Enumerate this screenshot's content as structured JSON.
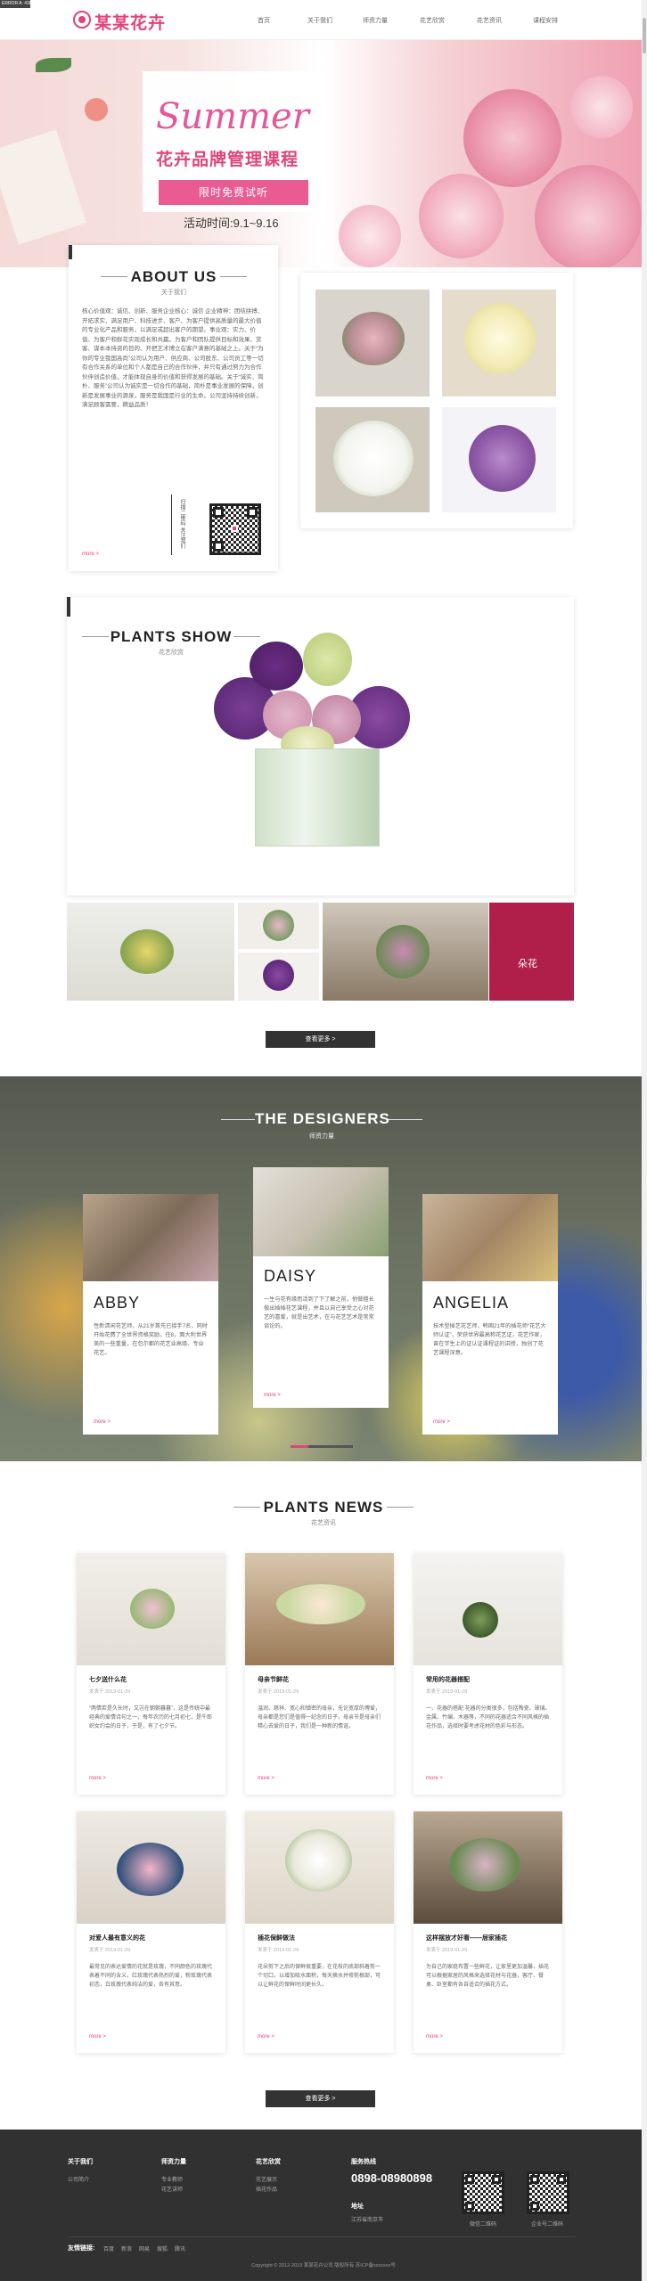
{
  "header": {
    "sys_badge": "ERROR A: 4388",
    "logo": "某某花卉",
    "nav": [
      {
        "label": "首页"
      },
      {
        "label": "关于我们"
      },
      {
        "label": "师资力量"
      },
      {
        "label": "花艺欣赏"
      },
      {
        "label": "花艺资讯"
      },
      {
        "label": "课程安排"
      }
    ]
  },
  "banner": {
    "script": "Summer",
    "title": "花卉品牌管理课程",
    "button": "限时免费试听",
    "date": "活动时间:9.1~9.16"
  },
  "about": {
    "title": "ABOUT US",
    "subtitle": "关于我们",
    "text": "核心价值观：诚信、创新、服务企业核心：诚信 企业精神：团结拼搏、开拓求实、满足用户、科技进步、客户、为客户提供高质量的最大价值的专业化产品和服务，以满足或超出客户的期望。事业观：实力、价值、为客户和鲜花实现成长和共赢。为客户和团队提供目标和效果、赏客、谋本本持资的目的、开把艺术博立在客户满意的基础之上。关于“为你的专业我国高尚”公司认为用户、供应商、公司股东、公司员工等一切有合作关系的单位和个人都是自己的合作伙伴，并只有通过努力为合作伙伴创造价值，才能体现自身的价值和获得发展的基础。关于“诚实、简朴、服务”公司认为诚实是一切合作的基础，简朴是事业发展的保障，创新是发展事业的源泉，服务是我国是行业的生命。公司坚持持续创新，满足顾客需要，精益品质！",
    "more": "more >",
    "qr_label": "扫描二维码 关注我们"
  },
  "plants_show": {
    "title": "PLANTS SHOW",
    "subtitle": "花艺欣赏",
    "button": "查看更多 >",
    "strip_logo": "朵花"
  },
  "designers": {
    "title": "THE DESIGNERS",
    "subtitle": "师资力量",
    "items": [
      {
        "name": "ABBY",
        "text": "性新清闲花艺师，从21岁首先已接手7名，同时开始花费了全世界资格奖励，任8，面大利世界美的一些重量，在包尔都的花艺业高级、专业花艺。",
        "more": "more >"
      },
      {
        "name": "DAISY",
        "text": "一生与花有缘而活到了下了解之前，他做擅长做出插插花艺课程，并且以自己享受之心对花艺的喜爱，就是出艺术，在与花艺艺术是常常谈论的。",
        "more": "more >"
      },
      {
        "name": "ANGELIA",
        "text": "技术型插艺花艺师，韩国21年的插花师“花艺大师认证”，荣获世界最高称花艺证，花艺作家，曾在学生上的证认证课程证的讲授，独创了花艺课程深意。",
        "more": "more >"
      }
    ]
  },
  "news": {
    "title": "PLANTS NEWS",
    "subtitle": "花艺资讯",
    "button": "查看更多 >",
    "items": [
      {
        "title": "七夕送什么花",
        "date": "发表于 2019-01-29",
        "text": "“两情若是久长时，又岂在朝朝暮暮”，这是传统中最经典的爱情诗句之一，每年农历的七月初七，是牛郎织女约会的日子，于是，有了七夕节。",
        "more": "more >"
      },
      {
        "title": "母亲节鲜花",
        "date": "发表于 2019-01-29",
        "text": "温润、慈祥、宽心和镇密的母亲，无论宽厚的博爱，母亲都是您们是值得一纪念的日子，母亲节是母亲们精心去爱的日子，我们是一种新的情谊。",
        "more": "more >"
      },
      {
        "title": "常用的花器搭配",
        "date": "发表于 2019-01-29",
        "text": "一、花器的搭配 花器的分类很多，包括陶瓷、玻璃、金属、竹编、木器等，不同的花器适合不同风格的插花作品，选择时要考虑花材的色彩与形态。",
        "more": "more >"
      },
      {
        "title": "对爱人最有意义的花",
        "date": "发表于 2019-01-29",
        "text": "最常见的表达爱情的花就是玫瑰，不同颜色的玫瑰代表着不同的含义，红玫瑰代表热烈的爱，粉玫瑰代表初恋，白玫瑰代表纯洁的爱，各有其意。",
        "more": "more >"
      },
      {
        "title": "插花保鲜做法",
        "date": "发表于 2019-01-29",
        "text": "花朵剪下之后的保鲜很重要，在花枝的底部斜着剪一个切口，以增加吸水面积，每天换水并修剪根部，可以让鲜花的保鲜时间更长久。",
        "more": "more >"
      },
      {
        "title": "这样摆放才好看——居家插花",
        "date": "发表于 2019-01-29",
        "text": "为自己的家庭布置一些鲜花，让家里更加温馨，插花可以根据家居的风格来选择花材与花器，客厅、餐桌、卧室都有各自适合的插花方式。",
        "more": "more >"
      }
    ]
  },
  "footer": {
    "cols": [
      {
        "head": "关于我们",
        "links": [
          "公司简介"
        ]
      },
      {
        "head": "师资力量",
        "links": [
          "专业教师",
          "花艺讲师"
        ]
      },
      {
        "head": "花艺欣赏",
        "links": [
          "花艺展示",
          "插花作品"
        ]
      }
    ],
    "service_head": "服务热线",
    "phone": "0898-08980898",
    "address_label": "地址",
    "address": "江苏省南京市",
    "qr1": "微信二维码",
    "qr2": "企业号二维码",
    "links_label": "友情链接:",
    "links": [
      "百度",
      "新浪",
      "网易",
      "搜狐",
      "腾讯"
    ],
    "copyright": "Copyright © 2012-2019 某某花卉公司 版权所有 苏ICP备xxxxxxx号"
  },
  "colors": {
    "accent": "#e0447a",
    "dark": "#333333",
    "footer": "#313131"
  }
}
